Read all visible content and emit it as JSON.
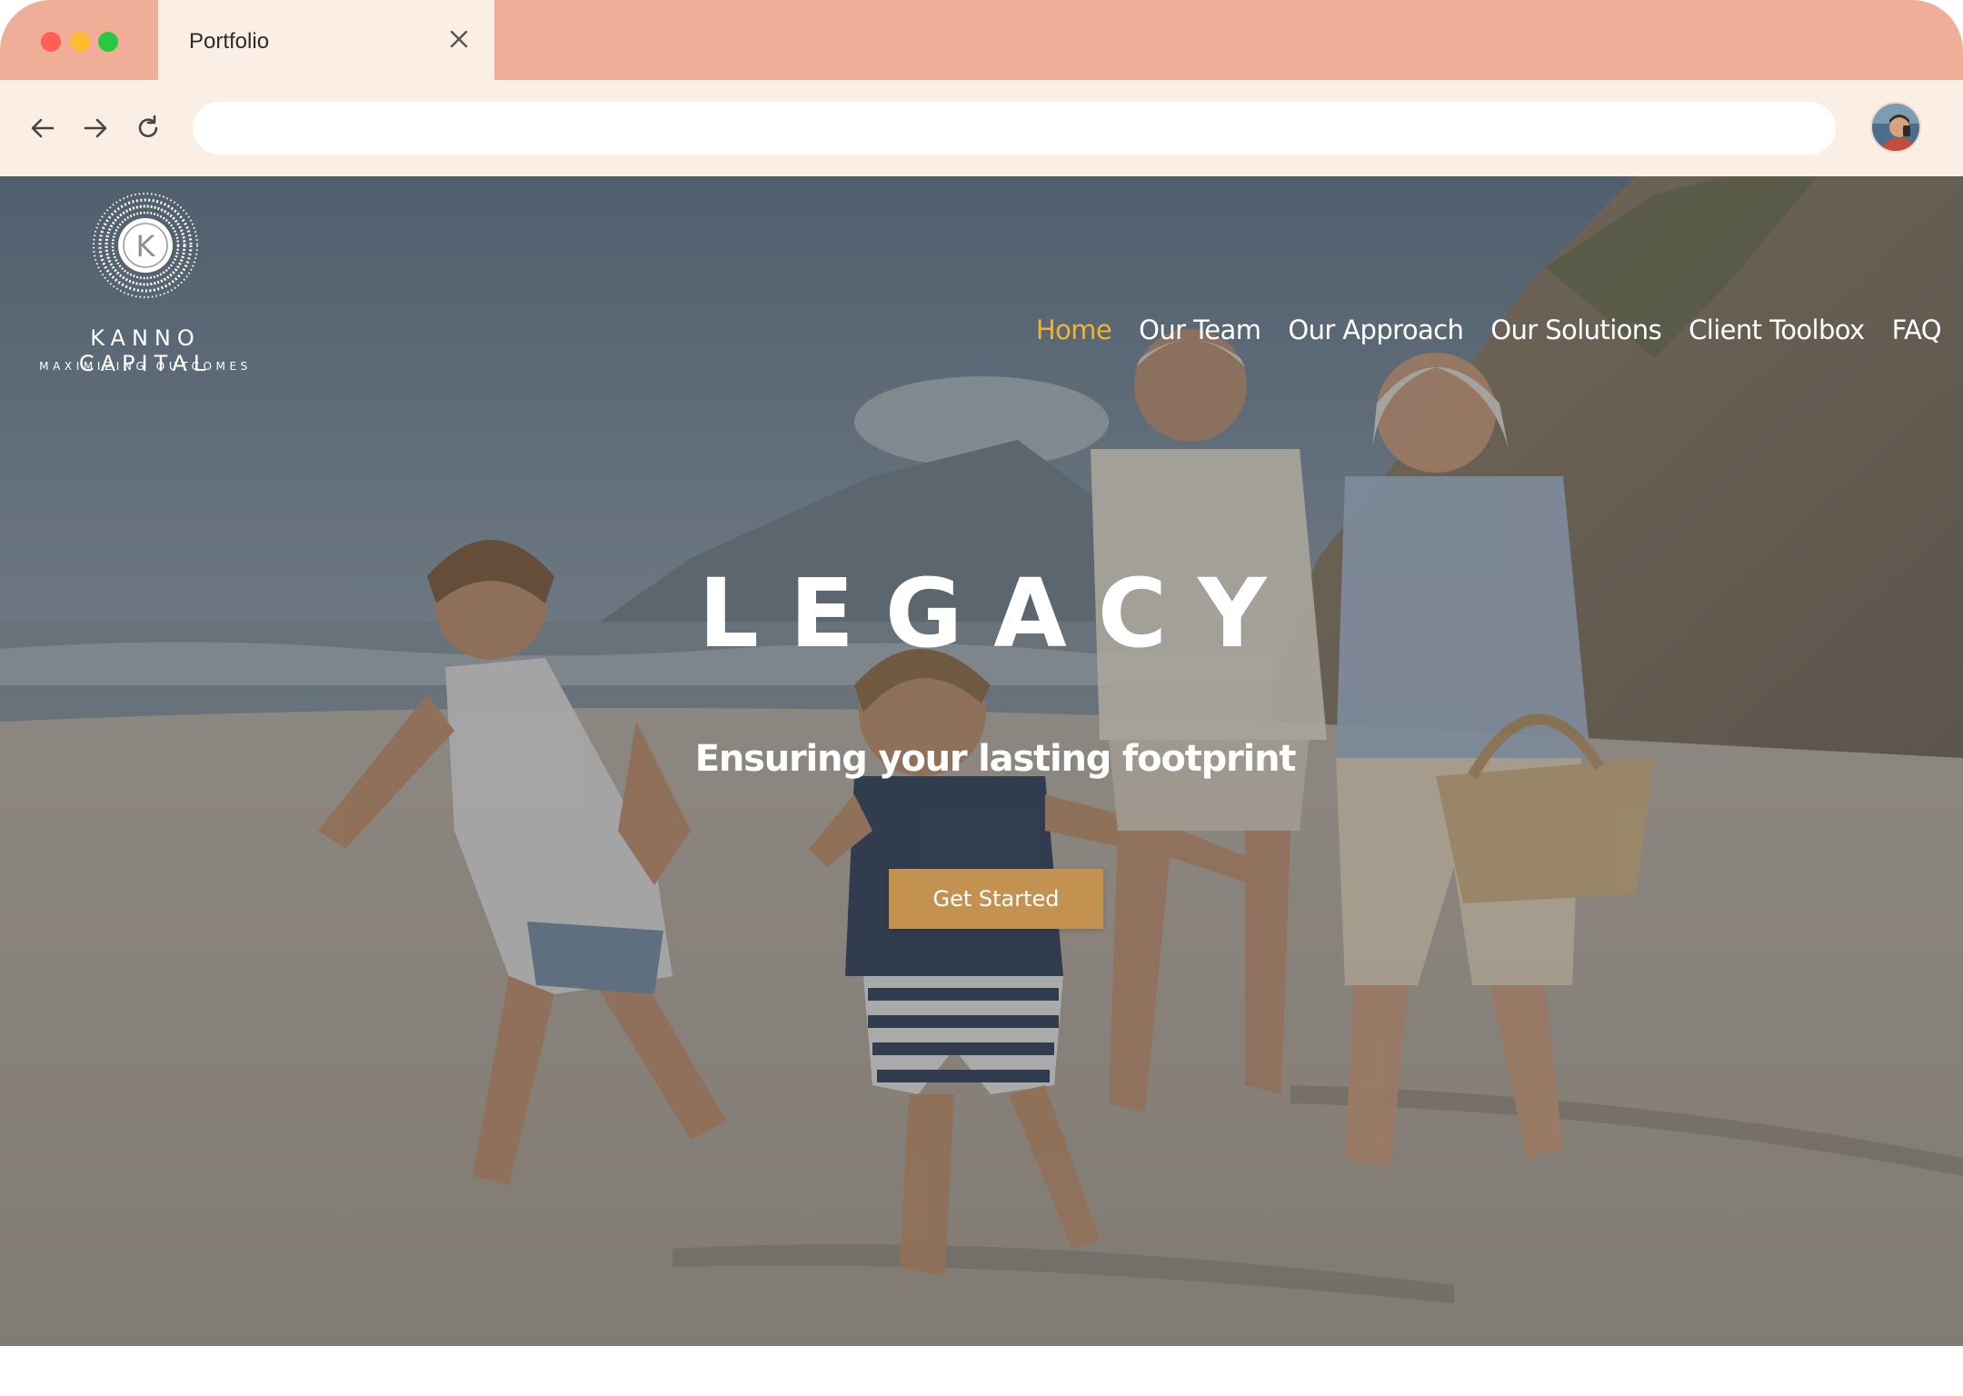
{
  "browser": {
    "tab_title": "Portfolio",
    "address_value": "",
    "address_placeholder": ""
  },
  "site": {
    "logo": {
      "name": "KANNO CAPITAL",
      "tagline": "MAXIMIZING OUTCOMES",
      "monogram": "K"
    },
    "nav": [
      {
        "label": "Home",
        "active": true
      },
      {
        "label": "Our Team",
        "active": false
      },
      {
        "label": "Our Approach",
        "active": false
      },
      {
        "label": "Our Solutions",
        "active": false
      },
      {
        "label": "Client Toolbox",
        "active": false
      },
      {
        "label": "FAQ",
        "active": false
      }
    ],
    "hero": {
      "title": "LEGACY",
      "subtitle": "Ensuring your lasting footprint",
      "cta_label": "Get Started"
    }
  },
  "colors": {
    "tabbar": "#f0ad97",
    "toolbar": "#fbefe5",
    "nav_active": "#f2b233",
    "cta": "#c39150"
  },
  "icons": [
    "back-arrow-icon",
    "forward-arrow-icon",
    "reload-icon",
    "close-icon"
  ]
}
